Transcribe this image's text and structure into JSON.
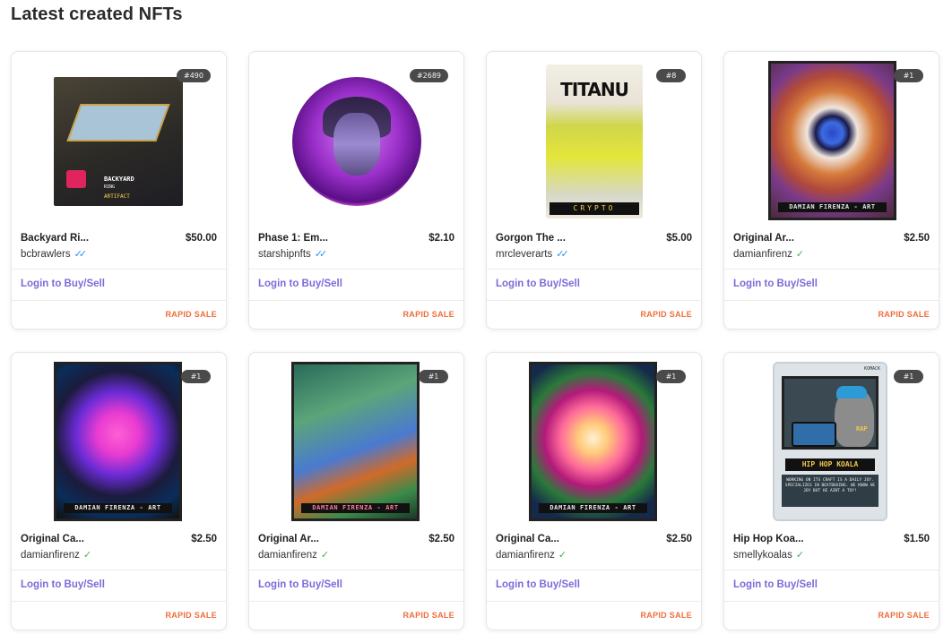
{
  "page": {
    "title": "Latest created NFTs"
  },
  "cards": [
    {
      "edition": "#490",
      "name": "Backyard Ri...",
      "price": "$50.00",
      "creator": "bcbrawlers",
      "verified": "blue",
      "login": "Login to Buy/Sell",
      "tag": "RAPID SALE",
      "art": "ring",
      "art_text": [
        "BACKYARD",
        "RING",
        "ARTIFACT"
      ]
    },
    {
      "edition": "#2689",
      "name": "Phase 1: Em...",
      "price": "$2.10",
      "creator": "starshipnfts",
      "verified": "blue",
      "login": "Login to Buy/Sell",
      "tag": "RAPID SALE",
      "art": "avatar"
    },
    {
      "edition": "#8",
      "name": "Gorgon The ...",
      "price": "$5.00",
      "creator": "mrcleverarts",
      "verified": "blue",
      "login": "Login to Buy/Sell",
      "tag": "RAPID SALE",
      "art": "bag",
      "art_text": [
        "TITANU",
        "CRYPTO"
      ]
    },
    {
      "edition": "#1",
      "name": "Original Ar...",
      "price": "$2.50",
      "creator": "damianfirenz",
      "verified": "green",
      "login": "Login to Buy/Sell",
      "tag": "RAPID SALE",
      "art": "eye",
      "art_text": [
        "DAMIAN FIRENZA - ART"
      ]
    },
    {
      "edition": "#1",
      "name": "Original Ca...",
      "price": "$2.50",
      "creator": "damianfirenz",
      "verified": "green",
      "login": "Login to Buy/Sell",
      "tag": "RAPID SALE",
      "art": "flower1",
      "art_text": [
        "DAMIAN FIRENZA - ART"
      ]
    },
    {
      "edition": "#1",
      "name": "Original Ar...",
      "price": "$2.50",
      "creator": "damianfirenz",
      "verified": "green",
      "login": "Login to Buy/Sell",
      "tag": "RAPID SALE",
      "art": "parrot",
      "art_text": [
        "DAMIAN FIRENZA - ART"
      ]
    },
    {
      "edition": "#1",
      "name": "Original Ca...",
      "price": "$2.50",
      "creator": "damianfirenz",
      "verified": "green",
      "login": "Login to Buy/Sell",
      "tag": "RAPID SALE",
      "art": "flower2",
      "art_text": [
        "DAMIAN FIRENZA - ART"
      ]
    },
    {
      "edition": "#1",
      "name": "Hip Hop Koa...",
      "price": "$1.50",
      "creator": "smellykoalas",
      "verified": "green",
      "login": "Login to Buy/Sell",
      "tag": "RAPID SALE",
      "art": "koala",
      "art_text": [
        "KOMACK",
        "RAP",
        "HIP HOP KOALA",
        "WORKING ON ITS CRAFT IS A DAILY JOY. SPECIALIZES IN BEATBOXING. WE KNOW HE JOY BUT HE AINT A TOY!"
      ]
    }
  ],
  "colors": {
    "link": "#7b6cd9",
    "rapid_sale": "#f06d3a",
    "verified_blue": "#2f8ff0",
    "verified_green": "#48b04c"
  },
  "icons": {
    "verified_blue": "double-check-icon",
    "verified_green": "check-icon"
  }
}
